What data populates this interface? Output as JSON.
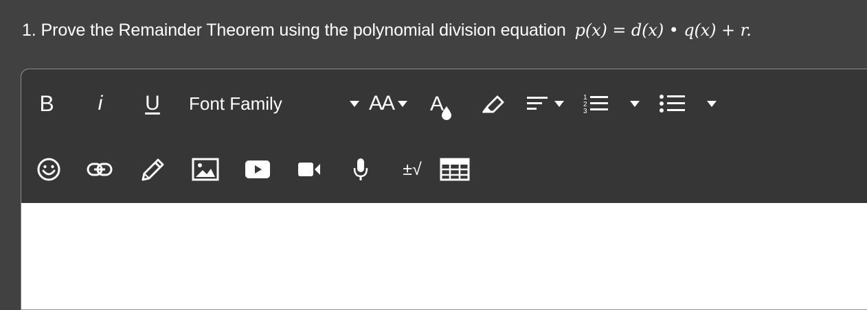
{
  "question": {
    "number": "1.",
    "text": "Prove the Remainder Theorem using the polynomial division equation",
    "equation": "p(x) = d(x) • q(x) + r."
  },
  "toolbar": {
    "bold_label": "B",
    "italic_label": "i",
    "underline_label": "U",
    "font_family_label": "Font Family",
    "font_size_label": "AA",
    "font_color_label": "A",
    "math_label": "±√",
    "row1_icons": [
      "bold",
      "italic",
      "underline",
      "font-family-dropdown",
      "font-size-dropdown",
      "font-color-icon",
      "highlight-icon",
      "align-dropdown",
      "ordered-list-dropdown",
      "unordered-list-dropdown"
    ],
    "row2_icons": [
      "emoji-icon",
      "link-icon",
      "pencil-icon",
      "image-icon",
      "video-play-icon",
      "camera-icon",
      "microphone-icon",
      "math-icon",
      "table-icon"
    ]
  },
  "editor": {
    "content": ""
  },
  "colors": {
    "page_bg": "#414141",
    "toolbar_bg": "#363636",
    "editor_bg": "#ffffff",
    "text": "#ffffff"
  }
}
